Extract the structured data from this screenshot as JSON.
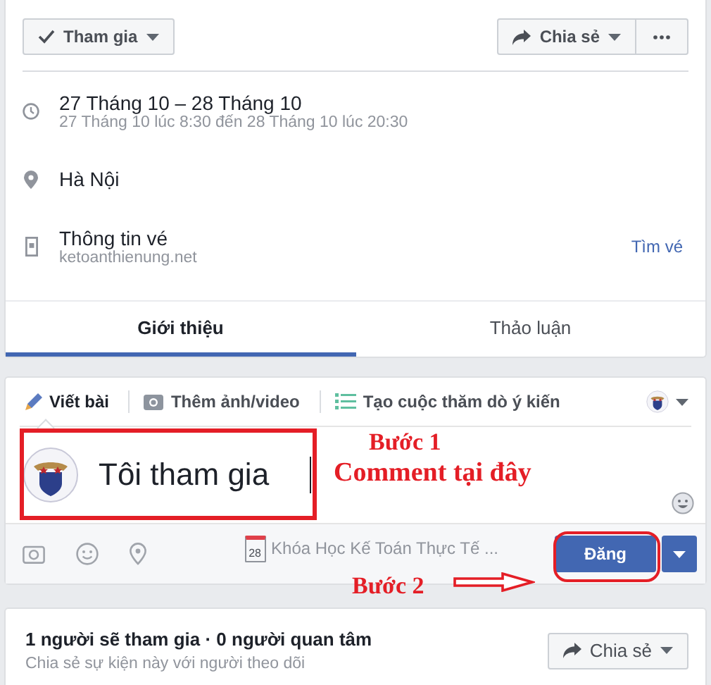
{
  "actions": {
    "join": {
      "label": "Tham gia"
    },
    "share": {
      "label": "Chia sẻ"
    }
  },
  "details": [
    {
      "kind": "time",
      "title": "27 Tháng 10 – 28 Tháng 10",
      "subtitle": "27 Tháng 10 lúc 8:30 đến 28 Tháng 10 lúc 20:30"
    },
    {
      "kind": "place",
      "title": "Hà Nội"
    },
    {
      "kind": "ticket",
      "title": "Thông tin vé",
      "subtitle": "ketoanthienung.net",
      "link": "Tìm vé"
    }
  ],
  "tabs": [
    {
      "label": "Giới thiệu",
      "selected": true
    },
    {
      "label": "Thảo luận",
      "selected": false
    }
  ],
  "composer": {
    "modes": [
      {
        "kind": "write",
        "label": "Viết bài",
        "selected": true
      },
      {
        "kind": "photo",
        "label": "Thêm ảnh/video",
        "selected": false
      },
      {
        "kind": "poll",
        "label": "Tạo cuộc thăm dò ý kiến",
        "selected": false
      }
    ],
    "value": "Tôi tham gia",
    "event_day": "28",
    "event_tag": "Khóa Học Kế Toán Thực Tế ...",
    "post_button": "Đăng"
  },
  "annotations": {
    "step1": "Bước 1",
    "step1_note": "Comment tại đây",
    "step2": "Bước 2"
  },
  "summary": {
    "title": "1 người sẽ tham gia · 0 người quan tâm",
    "subtitle": "Chia sẻ sự kiện này với người theo dõi",
    "share": "Chia sẻ"
  }
}
